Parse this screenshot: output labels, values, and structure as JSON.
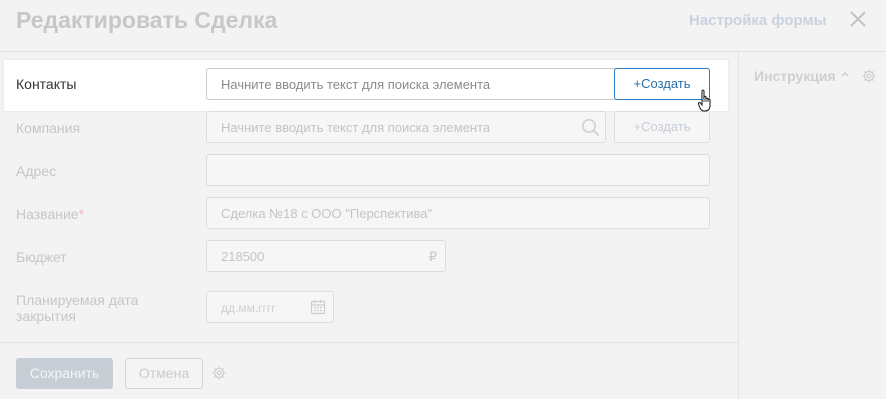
{
  "header": {
    "title": "Редактировать Сделка",
    "form_settings_label": "Настройка формы"
  },
  "instruction": {
    "label": "Инструкция"
  },
  "fields": {
    "contacts": {
      "label": "Контакты",
      "placeholder": "Начните вводить текст для поиска элемента",
      "create_label": "+Создать"
    },
    "company": {
      "label": "Компания",
      "placeholder": "Начните вводить текст для поиска элемента",
      "create_label": "+Создать"
    },
    "address": {
      "label": "Адрес",
      "value": ""
    },
    "name": {
      "label": "Название",
      "required_mark": "*",
      "value": "Сделка №18 с ООО \"Перспектива\""
    },
    "budget": {
      "label": "Бюджет",
      "value": "218500",
      "currency": "₽"
    },
    "close_date": {
      "label_line1": "Планируемая дата",
      "label_line2": "закрытия",
      "placeholder": "дд.мм.гггг"
    }
  },
  "footer": {
    "save_label": "Сохранить",
    "cancel_label": "Отмена"
  },
  "icons": {
    "close": "close-icon",
    "search": "search-icon",
    "calendar": "calendar-icon",
    "gear": "gear-icon",
    "chevron": "chevron-up-icon",
    "cursor": "hand-pointer-icon"
  },
  "colors": {
    "accent": "#2d7ec1",
    "required": "#f2b9b9",
    "save_button": "#c8ced6"
  }
}
